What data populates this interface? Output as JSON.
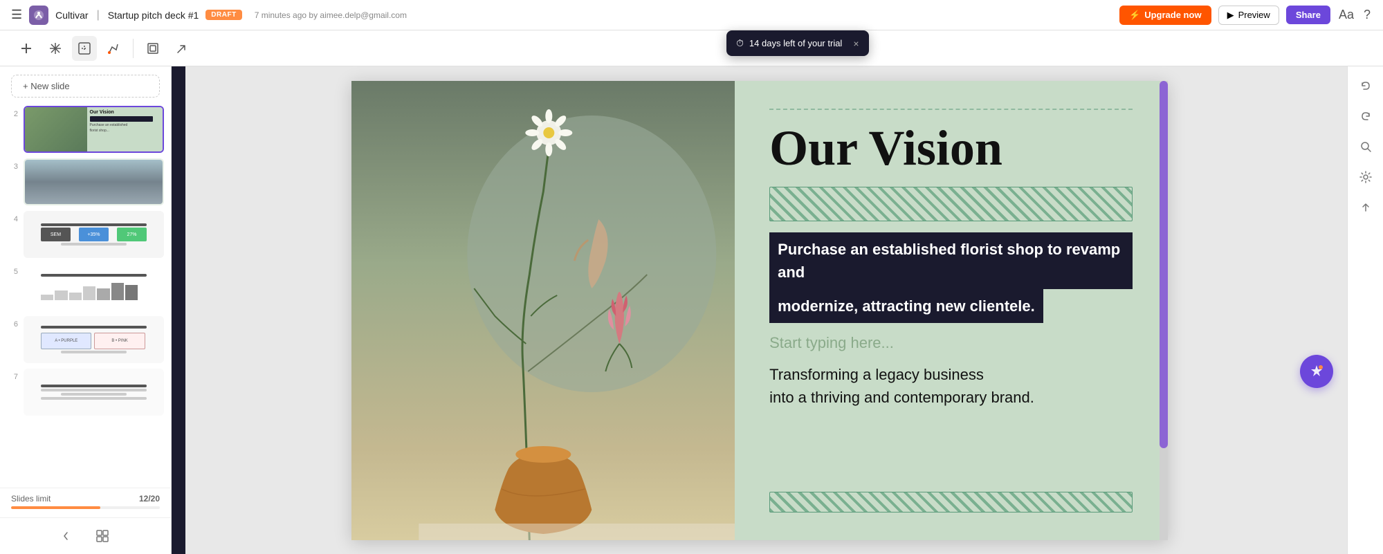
{
  "app": {
    "logo_alt": "Cultivar logo",
    "title": "Cultivar",
    "separator": "|",
    "doc_title": "Startup pitch deck #1",
    "draft_label": "DRAFT",
    "save_info": "7 minutes ago by aimee.delp@gmail.com"
  },
  "topbar": {
    "upgrade_label": "Upgrade now",
    "preview_label": "Preview",
    "share_label": "Share"
  },
  "trial": {
    "message": "14 days left of your trial",
    "close_label": "×"
  },
  "toolbar": {
    "tools": [
      "＋",
      "✛",
      "⊡",
      "✎",
      "⬜",
      "⤴"
    ]
  },
  "sidebar": {
    "new_slide_label": "+ New slide",
    "slides": [
      {
        "num": "2",
        "type": "vision"
      },
      {
        "num": "3",
        "type": "landscape"
      },
      {
        "num": "4",
        "type": "metrics"
      },
      {
        "num": "5",
        "type": "chart"
      },
      {
        "num": "6",
        "type": "comparison"
      },
      {
        "num": "7",
        "type": "text"
      }
    ],
    "limit_label": "Slides limit",
    "limit_count": "12/20",
    "limit_percent": 60
  },
  "slide": {
    "dotted_line_top": true,
    "title": "Our Vision",
    "stripe_placeholder": "",
    "highlight_line1": "Purchase an established florist shop to revamp and",
    "highlight_line2": "modernize, attracting new clientele.",
    "type_placeholder": "Start typing here...",
    "body_text_line1": "Transforming a legacy business",
    "body_text_line2": "into a thriving and contemporary brand.",
    "stripe_bottom": true
  },
  "right_panel": {
    "buttons": [
      "↩",
      "↪",
      "⚙",
      "🔍",
      "⌃"
    ]
  }
}
